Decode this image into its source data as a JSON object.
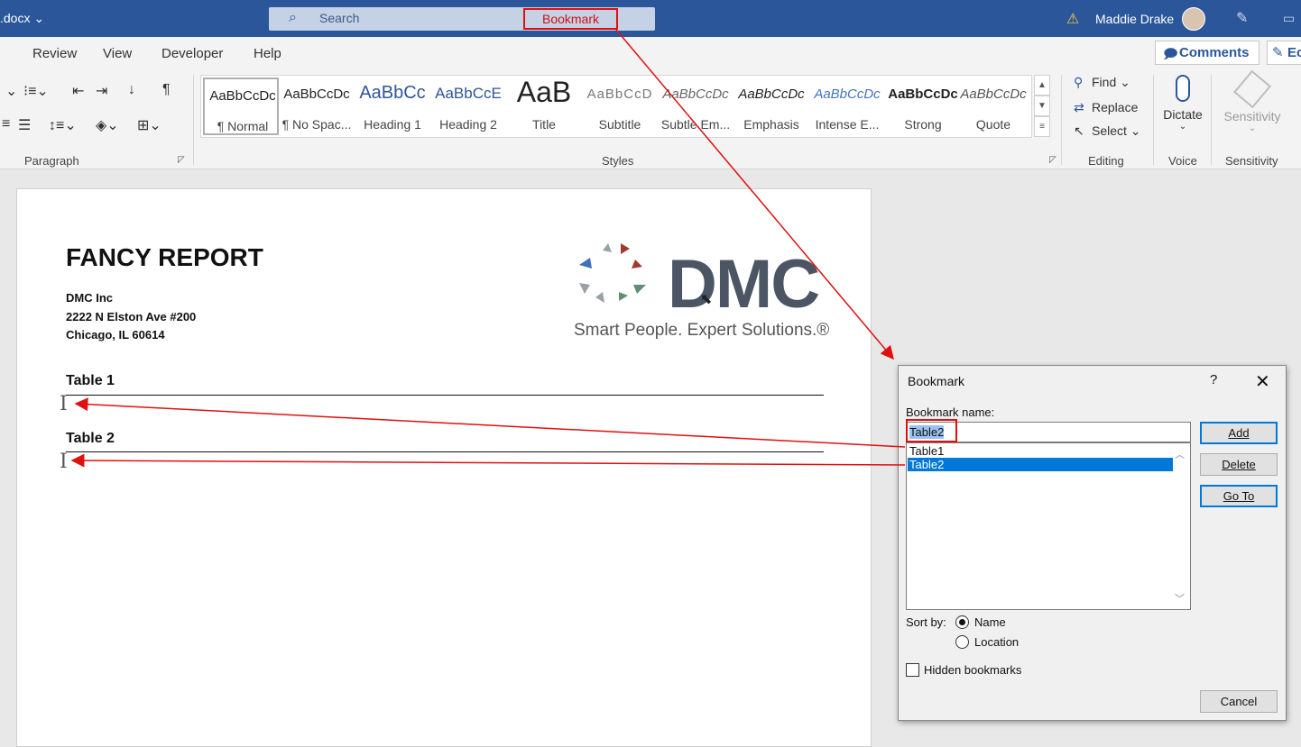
{
  "titlebar": {
    "doc_name": ".docx ⌄",
    "search_placeholder": "Search",
    "callout_text": "Bookmark",
    "user_name": "Maddie Drake"
  },
  "menu": [
    "Review",
    "View",
    "Developer",
    "Help"
  ],
  "comments_label": "Comments",
  "edit_label": "Ec",
  "ribbon": {
    "paragraph_label": "Paragraph",
    "styles_label": "Styles",
    "editing_label": "Editing",
    "voice_label": "Voice",
    "sensitivity_group_label": "Sensitivity",
    "styles": [
      {
        "preview": "AaBbCcDc",
        "name": "¶ Normal"
      },
      {
        "preview": "AaBbCcDc",
        "name": "¶ No Spac..."
      },
      {
        "preview": "AaBbCc",
        "name": "Heading 1"
      },
      {
        "preview": "AaBbCcE",
        "name": "Heading 2"
      },
      {
        "preview": "AaB",
        "name": "Title"
      },
      {
        "preview": "AaBbCcD",
        "name": "Subtitle"
      },
      {
        "preview": "AaBbCcDc",
        "name": "Subtle Em..."
      },
      {
        "preview": "AaBbCcDc",
        "name": "Emphasis"
      },
      {
        "preview": "AaBbCcDc",
        "name": "Intense E..."
      },
      {
        "preview": "AaBbCcDc",
        "name": "Strong"
      },
      {
        "preview": "AaBbCcDc",
        "name": "Quote"
      }
    ],
    "find_label": "Find",
    "replace_label": "Replace",
    "select_label": "Select",
    "dictate_label": "Dictate",
    "sensitivity_label": "Sensitivity"
  },
  "document": {
    "title": "FANCY REPORT",
    "address": [
      "DMC Inc",
      "2222 N Elston Ave #200",
      "Chicago, IL 60614"
    ],
    "table1_heading": "Table 1",
    "table2_heading": "Table 2",
    "logo_text": "DMC",
    "tagline": "Smart People. Expert Solutions.®"
  },
  "dialog": {
    "title": "Bookmark",
    "help": "?",
    "close": "✕",
    "name_label": "Bookmark name:",
    "name_value": "Table2",
    "bookmarks": [
      "Table1",
      "Table2"
    ],
    "selected_bookmark": "Table2",
    "add": "Add",
    "delete": "Delete",
    "goto": "Go To",
    "sort_by_label": "Sort by:",
    "sort_name": "Name",
    "sort_location": "Location",
    "sort_selected": "Name",
    "hidden_label": "Hidden bookmarks",
    "hidden_checked": false,
    "cancel": "Cancel"
  },
  "colors": {
    "title_bar": "#2b579a",
    "callout": "#e01010",
    "selection": "#0078d7"
  }
}
